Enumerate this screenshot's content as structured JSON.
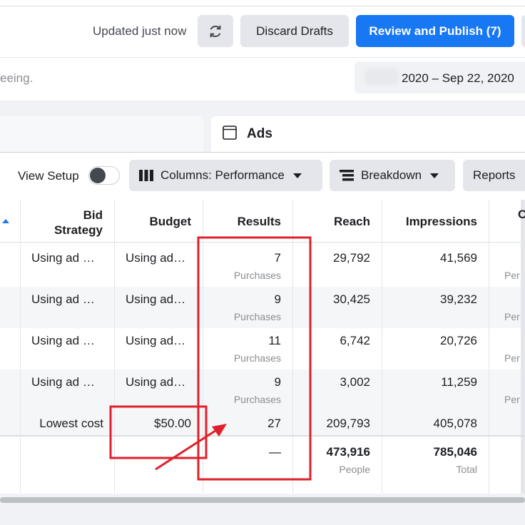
{
  "header": {
    "updated_text": "Updated just now",
    "refresh_icon": "refresh-icon",
    "discard_label": "Discard Drafts",
    "publish_label": "Review and Publish (7)"
  },
  "subheader": {
    "truncated_text": "eeing.",
    "date_range": "2020 – Sep 22, 2020"
  },
  "tabs": {
    "ads_label": "Ads",
    "ads_icon": "window-icon"
  },
  "toolbar": {
    "view_setup_label": "View Setup",
    "columns_label": "Columns: Performance",
    "breakdown_label": "Breakdown",
    "reports_label": "Reports"
  },
  "table": {
    "headers": {
      "bid_strategy": [
        "Bid",
        "Strategy"
      ],
      "budget": "Budget",
      "results": "Results",
      "reach": "Reach",
      "impressions": "Impressions",
      "next": "C"
    },
    "rows": [
      {
        "bid": "Using ad …",
        "budget": "Using ad…",
        "results": "7",
        "results_sub": "Purchases",
        "reach": "29,792",
        "impressions": "41,569",
        "next_sub": "Per"
      },
      {
        "bid": "Using ad …",
        "budget": "Using ad…",
        "results": "9",
        "results_sub": "Purchases",
        "reach": "30,425",
        "impressions": "39,232",
        "next_sub": "Per"
      },
      {
        "bid": "Using ad …",
        "budget": "Using ad…",
        "results": "11",
        "results_sub": "Purchases",
        "reach": "6,742",
        "impressions": "20,726",
        "next_sub": "Per"
      },
      {
        "bid": "Using ad …",
        "budget": "Using ad…",
        "results": "9",
        "results_sub": "Purchases",
        "reach": "3,002",
        "impressions": "11,259",
        "next_sub": "Per"
      },
      {
        "bid": "Lowest cost",
        "budget": "$50.00",
        "results": "27",
        "reach": "209,793",
        "impressions": "405,078"
      }
    ],
    "totals": {
      "results": "—",
      "reach": "473,916",
      "reach_sub": "People",
      "impressions": "785,046",
      "impressions_sub": "Total"
    }
  },
  "colors": {
    "accent": "#1877f2",
    "annotation": "#e0202a"
  }
}
